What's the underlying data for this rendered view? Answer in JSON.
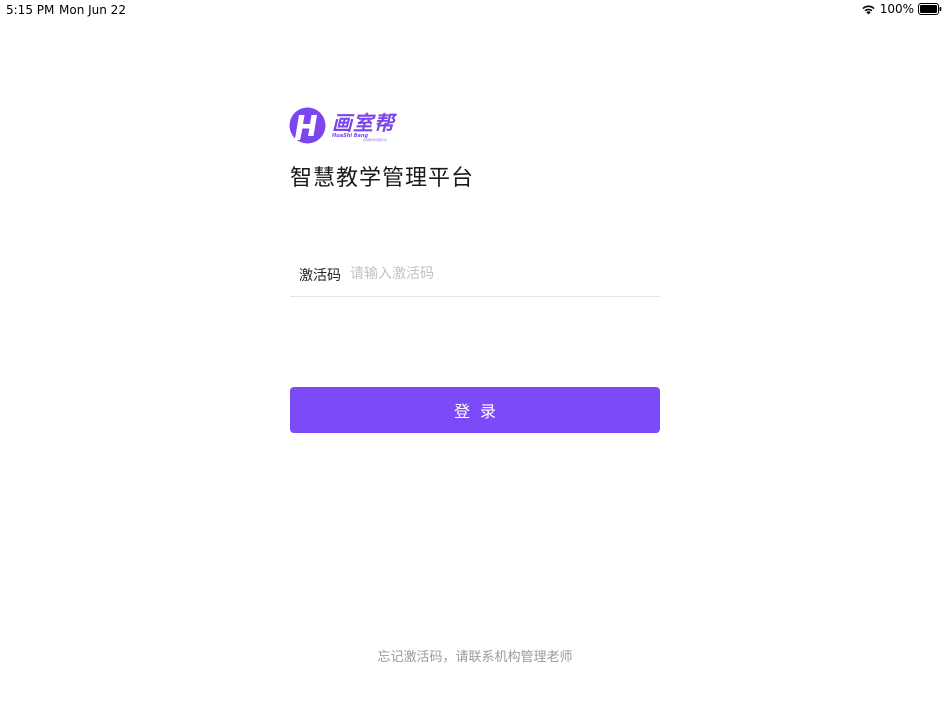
{
  "status_bar": {
    "time": "5:15 PM",
    "date": "Mon Jun 22",
    "battery_percent": "100%",
    "icons": [
      "wifi-icon",
      "battery-icon"
    ]
  },
  "logo": {
    "name": "画室帮",
    "subtitle": "HuaShi Bang",
    "tagline": "智慧教学管理平台"
  },
  "platform_title": "智慧教学管理平台",
  "activation": {
    "label": "激活码",
    "value": "",
    "placeholder": "请输入激活码"
  },
  "login_button": {
    "label": "登录"
  },
  "hint": "忘记激活码，请联系机构管理老师",
  "colors": {
    "accent": "#7d4af7",
    "logo": "#7b45f0",
    "placeholder": "#c2c2c2",
    "hint": "#9a9a9a"
  }
}
